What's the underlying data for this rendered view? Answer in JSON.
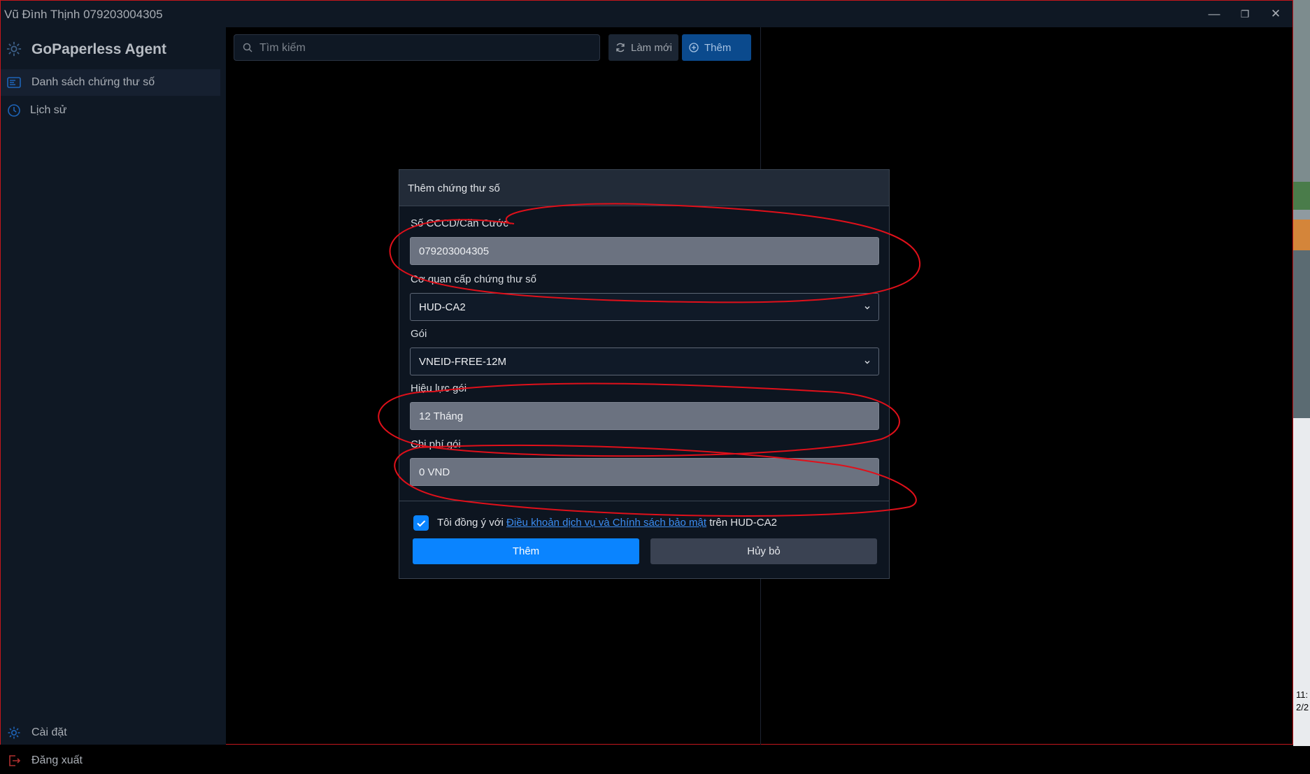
{
  "window": {
    "title": "Vũ Đình Thịnh 079203004305",
    "minimize_glyph": "—",
    "restore_glyph": "❐",
    "close_glyph": "✕"
  },
  "sidebar": {
    "app_name": "GoPaperless Agent",
    "logo_icon": "gear-icon",
    "items": [
      {
        "label": "Danh sách chứng thư số",
        "icon": "certificate-list-icon",
        "active": true
      },
      {
        "label": "Lịch sử",
        "icon": "clock-icon",
        "active": false
      }
    ],
    "bottom_items": [
      {
        "label": "Cài đặt",
        "icon": "gear-icon"
      },
      {
        "label": "Đăng xuất",
        "icon": "logout-icon"
      }
    ]
  },
  "toolbar": {
    "search_placeholder": "Tìm kiếm",
    "refresh_label": "Làm mới",
    "add_label": "Thêm"
  },
  "modal": {
    "title": "Thêm chứng thư số",
    "fields": {
      "id_label": "Số CCCD/Căn Cước",
      "id_value": "079203004305",
      "ca_label": "Cơ quan cấp chứng thư số",
      "ca_value": "HUD-CA2",
      "package_label": "Gói",
      "package_value": "VNEID-FREE-12M",
      "validity_label": "Hiệu lực gói",
      "validity_value": "12 Tháng",
      "cost_label": "Chi phí gói",
      "cost_value": "0 VND"
    },
    "agree": {
      "prefix": "Tôi đồng ý với ",
      "link": "Điều khoản dịch vụ và Chính sách bảo mật",
      "suffix": " trên HUD-CA2",
      "checked": true
    },
    "submit_label": "Thêm",
    "cancel_label": "Hủy bỏ"
  },
  "taskbar_fragment": {
    "time": "11:",
    "date": "2/2"
  },
  "colors": {
    "accent": "#0a84ff",
    "sidebar_bg": "#0f1824",
    "annotation": "#e0101a"
  }
}
